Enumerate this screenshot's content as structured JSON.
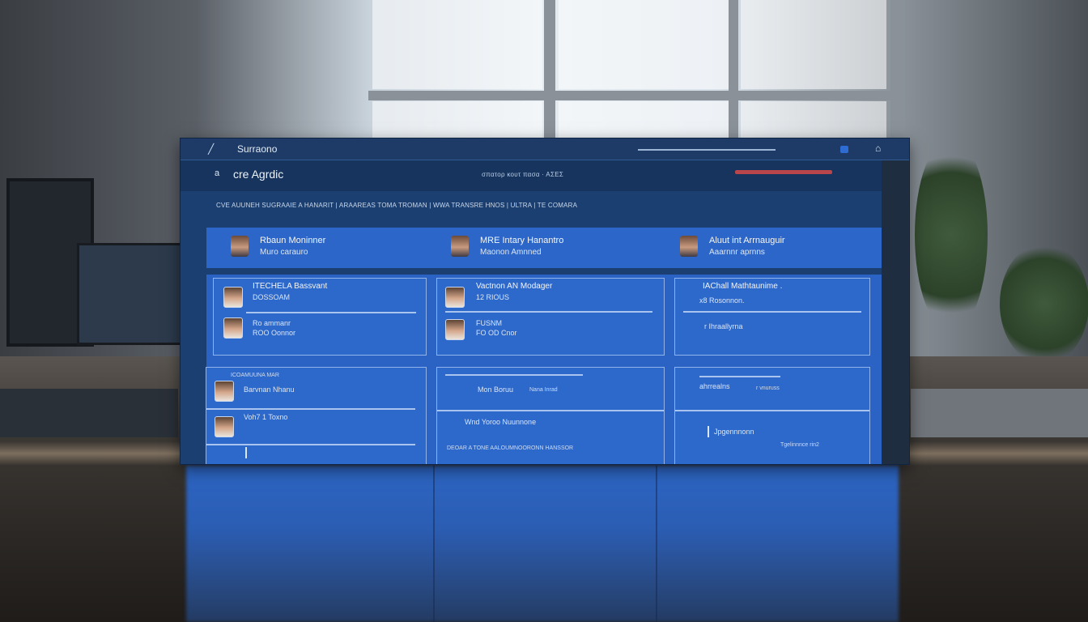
{
  "window": {
    "title": "Surraono",
    "close_glyph": "⌂"
  },
  "header": {
    "menu_glyph": "a",
    "title": "cre Agrdic",
    "links": "σπατορ κουτ πασα · ΑΣΕΣ"
  },
  "breadcrumb": "CVE AUUNEH SUGRAAIE A HANARIT | ARAAREAS TOMA TROMAN | WWA TRANSRE HNOS | ULTRA | TE COMARA",
  "people": [
    {
      "name": "Rbaun Moninner",
      "role": "Muro carauro"
    },
    {
      "name": "MRE Intary Hanantro",
      "role": "Maonon Amnned"
    },
    {
      "name": "Aluut int Arrnauguir",
      "role": "Aaarnnr aprnns"
    }
  ],
  "cards": {
    "top_left": {
      "title": "ITECHELA Bassvant",
      "sub": "DOSSOAM",
      "row2_title": "Ro ammanr",
      "row2_sub": "ROO Oonnor"
    },
    "top_mid": {
      "title": "Vactnon AN Modager",
      "sub": "12 RIOUS",
      "row2_title": "FUSNM",
      "row2_sub": "FO OD Cnor"
    },
    "top_right": {
      "title": "IAChall Mathtaunime .",
      "sub": "x8 Rosonnon.",
      "row2_title": "r Ihraallyrna"
    },
    "bot_left": {
      "title": "ICOAMUUNA MAR",
      "sub": "Barvnan Nhanu",
      "row2_title": "Voh7 1 Toxno"
    },
    "bot_mid": {
      "title": "Mon Boruu",
      "sub": "Nana Inrad",
      "row2_title": "Wnd  Yoroo  Nuunnone",
      "row2_sub": "DEOAR A TONE AALOUMNOORONN HANSSOR"
    },
    "bot_right": {
      "title": "ahrrealns",
      "sub": "r vnuruss",
      "row2_title": "Jpgennnonn",
      "row2_sub": "Tgelinnnce rin2"
    }
  },
  "icons": {
    "title_icon": "pen-icon",
    "menu_icon": "menu-icon",
    "close_icon": "close-icon"
  },
  "colors": {
    "accent": "#2c66c9",
    "frame": "#1b3f70",
    "badge": "#b8464a"
  }
}
